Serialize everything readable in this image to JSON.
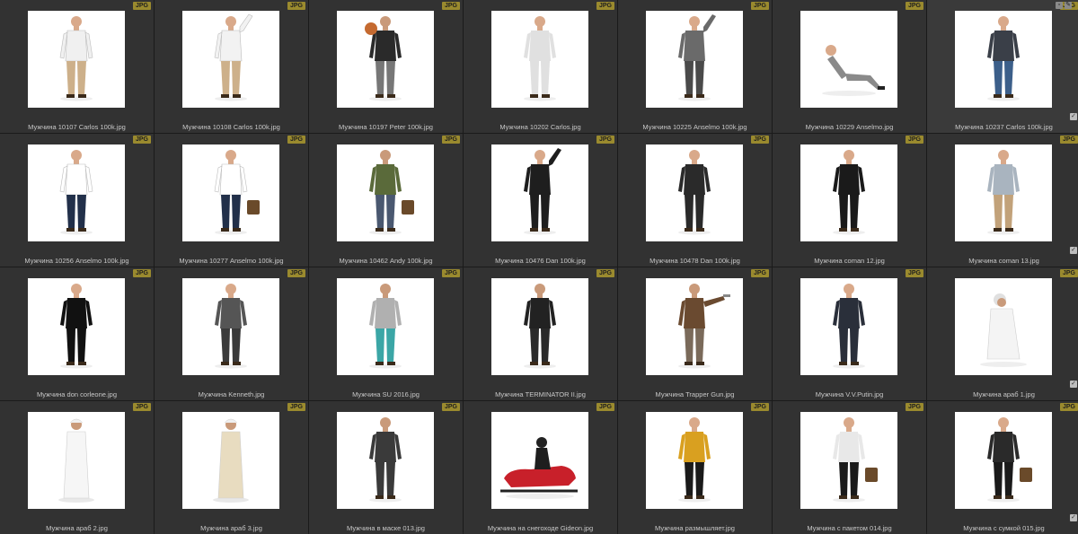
{
  "badge_text": "JPG",
  "colors": {
    "cell_bg": "#323232",
    "badge_bg": "#9a8a2e",
    "label": "#c8c8c8",
    "thumb_bg": "#ffffff"
  },
  "items": [
    {
      "name": "Мужчина 10107 Carlos 100k.jpg"
    },
    {
      "name": "Мужчина 10108 Carlos 100k.jpg"
    },
    {
      "name": "Мужчина 10197 Peter 100k.jpg"
    },
    {
      "name": "Мужчина 10202 Carlos.jpg"
    },
    {
      "name": "Мужчина 10225 Anselmo 100k.jpg"
    },
    {
      "name": "Мужчина 10229 Anselmo.jpg"
    },
    {
      "name": "Мужчина 10237 Carlos 100k.jpg"
    },
    {
      "name": "Мужчина 10256 Anselmo 100k.jpg"
    },
    {
      "name": "Мужчина 10277 Anselmo 100k.jpg"
    },
    {
      "name": "Мужчина 10462 Andy 100k.jpg"
    },
    {
      "name": "Мужчина 10476 Dan 100k.jpg"
    },
    {
      "name": "Мужчина 10478 Dan 100k.jpg"
    },
    {
      "name": "Мужчина coman 12.jpg"
    },
    {
      "name": "Мужчина coman 13.jpg"
    },
    {
      "name": "Мужчина don corleone.jpg"
    },
    {
      "name": "Мужчина Kenneth.jpg"
    },
    {
      "name": "Мужчина SU 2016.jpg"
    },
    {
      "name": "Мужчина TERMINATOR II.jpg"
    },
    {
      "name": "Мужчина Trapper Gun.jpg"
    },
    {
      "name": "Мужчина V.V.Putin.jpg"
    },
    {
      "name": "Мужчина араб 1.jpg"
    },
    {
      "name": "Мужчина араб 2.jpg"
    },
    {
      "name": "Мужчина араб 3.jpg"
    },
    {
      "name": "Мужчина в маске 013.jpg"
    },
    {
      "name": "Мужчина на снегоходе Gideon.jpg"
    },
    {
      "name": "Мужчина размышляет.jpg"
    },
    {
      "name": "Мужчина с пакетом 014.jpg"
    },
    {
      "name": "Мужчина с сумкой 015.jpg"
    }
  ]
}
